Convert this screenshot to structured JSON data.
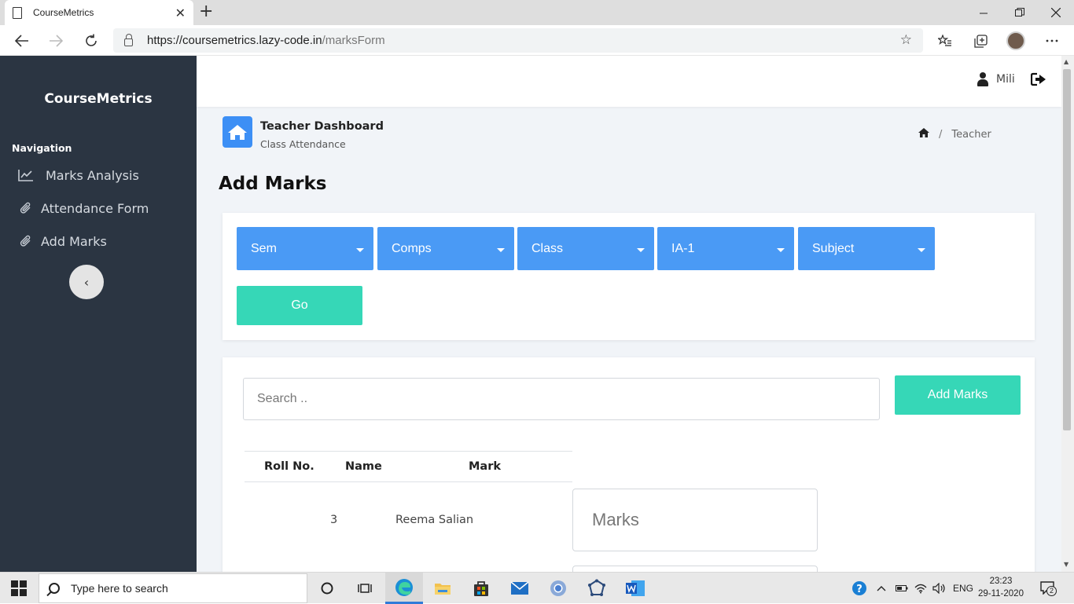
{
  "browser": {
    "tab_title": "CourseMetrics",
    "tab_close": "✕",
    "new_tab": "+",
    "url_host": "https://coursemetrics.lazy-code.in",
    "url_path": "/marksForm"
  },
  "sidebar": {
    "brand": "CourseMetrics",
    "heading": "Navigation",
    "items": [
      {
        "label": "Marks Analysis",
        "icon": "chart-line-icon"
      },
      {
        "label": "Attendance Form",
        "icon": "paperclip-icon"
      },
      {
        "label": "Add Marks",
        "icon": "paperclip-icon"
      }
    ],
    "collapse_glyph": "‹"
  },
  "topbar": {
    "user_name": "Mili"
  },
  "header": {
    "dashboard_title": "Teacher Dashboard",
    "dashboard_subtitle": "Class Attendance",
    "breadcrumb_separator": "/",
    "breadcrumb_current": "Teacher"
  },
  "page": {
    "title": "Add Marks"
  },
  "filters": {
    "dropdowns": [
      {
        "label": "Sem"
      },
      {
        "label": "Comps"
      },
      {
        "label": "Class"
      },
      {
        "label": "IA-1"
      },
      {
        "label": "Subject"
      }
    ],
    "go_label": "Go"
  },
  "marks_table": {
    "search_placeholder": "Search ..",
    "add_button": "Add Marks",
    "columns": [
      "Roll No.",
      "Name",
      "Mark"
    ],
    "rows": [
      {
        "roll": "3",
        "name": "Reema Salian",
        "mark_placeholder": "Marks"
      }
    ]
  },
  "taskbar": {
    "search_placeholder": "Type here to search",
    "tray_lang": "ENG",
    "time": "23:23",
    "date": "29-11-2020",
    "notification_count": "2"
  },
  "colors": {
    "sidebar_bg": "#2b3542",
    "accent_blue": "#4a9af5",
    "accent_teal": "#36d7b7",
    "main_bg": "#f1f4f8"
  }
}
